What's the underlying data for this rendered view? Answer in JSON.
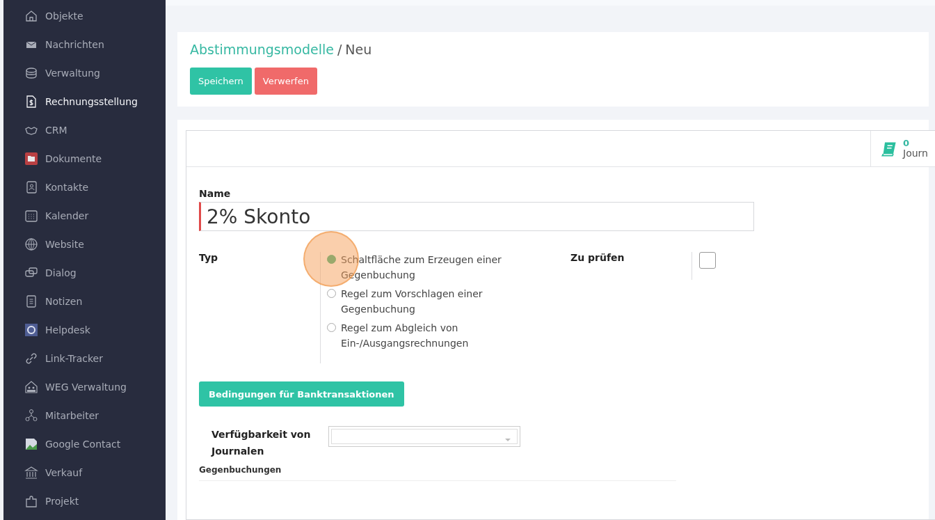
{
  "sidebar": {
    "items": [
      {
        "label": "Objekte",
        "selected": false
      },
      {
        "label": "Nachrichten",
        "selected": false
      },
      {
        "label": "Verwaltung",
        "selected": false
      },
      {
        "label": "Rechnungsstellung",
        "selected": true
      },
      {
        "label": "CRM",
        "selected": false
      },
      {
        "label": "Dokumente",
        "selected": false
      },
      {
        "label": "Kontakte",
        "selected": false
      },
      {
        "label": "Kalender",
        "selected": false
      },
      {
        "label": "Website",
        "selected": false
      },
      {
        "label": "Dialog",
        "selected": false
      },
      {
        "label": "Notizen",
        "selected": false
      },
      {
        "label": "Helpdesk",
        "selected": false
      },
      {
        "label": "Link-Tracker",
        "selected": false
      },
      {
        "label": "WEG Verwaltung",
        "selected": false
      },
      {
        "label": "Mitarbeiter",
        "selected": false
      },
      {
        "label": "Google Contact",
        "selected": false
      },
      {
        "label": "Verkauf",
        "selected": false
      },
      {
        "label": "Projekt",
        "selected": false
      }
    ]
  },
  "breadcrumb": {
    "parent": "Abstimmungsmodelle",
    "separator": "/",
    "current": "Neu"
  },
  "buttons": [
    {
      "label": "Speichern",
      "kind": "primary"
    },
    {
      "label": "Verwerfen",
      "kind": "danger"
    }
  ],
  "smart_button": {
    "count": "0",
    "label": "Journ"
  },
  "form": {
    "name_label": "Name",
    "name_value": "2% Skonto",
    "type_label": "Typ",
    "type_options": [
      {
        "label": "Schaltfläche zum Erzeugen einer Gegenbuchung",
        "selected": true
      },
      {
        "label": "Regel zum Vorschlagen einer Gegenbuchung",
        "selected": false
      },
      {
        "label": "Regel zum Abgleich von Ein-/Ausgangsrechnungen",
        "selected": false
      }
    ],
    "check_label": "Zu prüfen",
    "checked": false,
    "section_button": "Bedingungen für Banktransaktionen",
    "journals_label": "Verfügbarkeit von Journalen",
    "counter_label": "Gegenbuchungen"
  }
}
